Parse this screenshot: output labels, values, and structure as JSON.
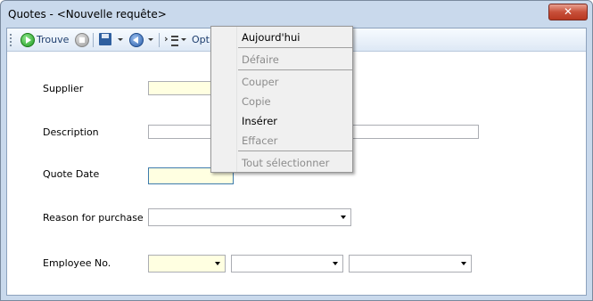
{
  "window": {
    "title": "Quotes - <Nouvelle requête>",
    "close_glyph": "✕"
  },
  "toolbar": {
    "find_label": "Trouve",
    "options_label": "Opti",
    "icons": [
      "find-icon",
      "stop-icon",
      "save-icon",
      "back-icon",
      "run-icon",
      "lines-icon"
    ]
  },
  "form": {
    "supplier_label": "Supplier",
    "description_label": "Description",
    "quote_date_label": "Quote Date",
    "reason_label": "Reason for purchase",
    "employee_label": "Employee No."
  },
  "context_menu": {
    "items": [
      {
        "label": "Aujourd'hui",
        "enabled": true
      },
      {
        "label": "Défaire",
        "enabled": false
      },
      {
        "label": "Couper",
        "enabled": false
      },
      {
        "label": "Copie",
        "enabled": false
      },
      {
        "label": "Insérer",
        "enabled": true
      },
      {
        "label": "Effacer",
        "enabled": false
      },
      {
        "label": "Tout sélectionner",
        "enabled": false
      }
    ]
  },
  "colors": {
    "required_field": "#ffffe1",
    "titlebar": "#c9d9ec",
    "close_button": "#c8503a"
  }
}
